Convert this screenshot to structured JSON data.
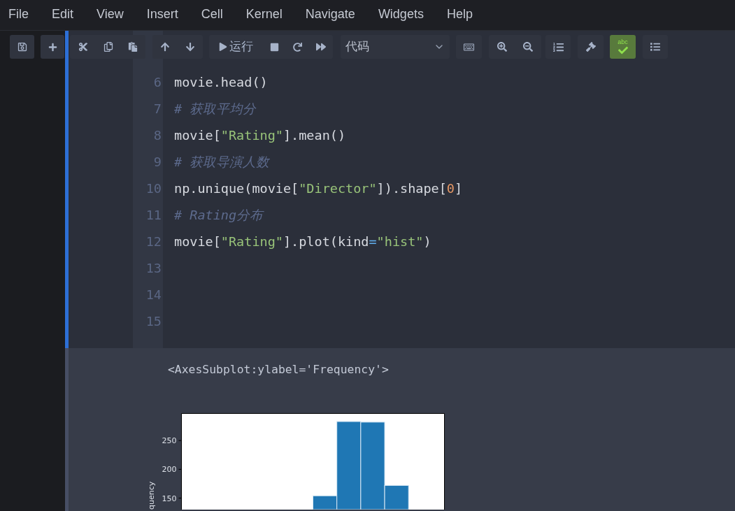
{
  "menu": [
    "File",
    "Edit",
    "View",
    "Insert",
    "Cell",
    "Kernel",
    "Navigate",
    "Widgets",
    "Help"
  ],
  "toolbar": {
    "run_label": "运行",
    "cell_type": "代码",
    "spellcheck": {
      "label": "abc",
      "on": true
    }
  },
  "cell": {
    "selected": true,
    "lines": [
      {
        "number": "6",
        "tokens": [
          {
            "kind": "code",
            "text": "movie.head()"
          }
        ]
      },
      {
        "number": "7",
        "tokens": [
          {
            "kind": "comment",
            "text": "# 获取平均分"
          }
        ]
      },
      {
        "number": "8",
        "tokens": [
          {
            "kind": "code",
            "text": "movie["
          },
          {
            "kind": "string",
            "text": "\"Rating\""
          },
          {
            "kind": "code",
            "text": "].mean()"
          }
        ]
      },
      {
        "number": "9",
        "tokens": [
          {
            "kind": "comment",
            "text": "# 获取导演人数"
          }
        ]
      },
      {
        "number": "10",
        "tokens": [
          {
            "kind": "code",
            "text": "np.unique(movie["
          },
          {
            "kind": "string",
            "text": "\"Director\""
          },
          {
            "kind": "code",
            "text": "]).shape["
          },
          {
            "kind": "number",
            "text": "0"
          },
          {
            "kind": "code",
            "text": "]"
          }
        ]
      },
      {
        "number": "11",
        "tokens": [
          {
            "kind": "comment",
            "text": "# Rating分布"
          }
        ]
      },
      {
        "number": "12",
        "tokens": [
          {
            "kind": "code",
            "text": "movie["
          },
          {
            "kind": "string",
            "text": "\"Rating\""
          },
          {
            "kind": "code",
            "text": "].plot(kind"
          },
          {
            "kind": "operator",
            "text": "="
          },
          {
            "kind": "string",
            "text": "\"hist\""
          },
          {
            "kind": "code",
            "text": ")"
          }
        ]
      },
      {
        "number": "13"
      },
      {
        "number": "14"
      },
      {
        "number": "15"
      }
    ],
    "output": {
      "text": "<AxesSubplot:ylabel='Frequency'>",
      "chart_data": {
        "type": "bar",
        "orientation": "vertical",
        "ylabel": "quency",
        "categories": [
          null,
          null,
          null,
          null,
          null,
          null,
          null,
          null,
          null,
          null
        ],
        "values": [
          null,
          null,
          null,
          null,
          null,
          154,
          283,
          282,
          172,
          null
        ],
        "ylim": [
          130,
          297
        ],
        "yticks": [
          150,
          200,
          250
        ]
      }
    }
  }
}
